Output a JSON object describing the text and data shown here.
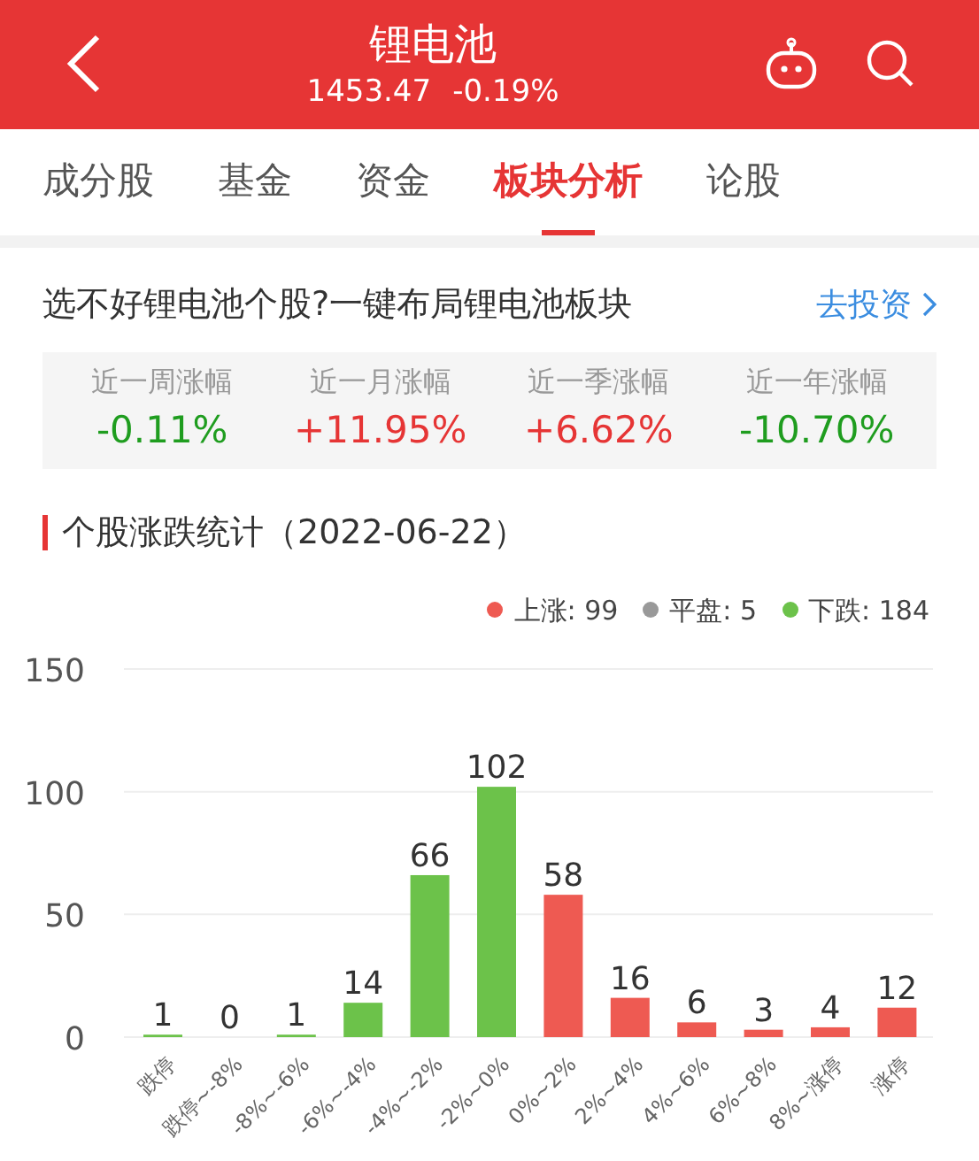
{
  "header": {
    "title": "锂电池",
    "price": "1453.47",
    "change": "-0.19%"
  },
  "tabs": [
    {
      "label": "成分股",
      "selected": false
    },
    {
      "label": "基金",
      "selected": false
    },
    {
      "label": "资金",
      "selected": false
    },
    {
      "label": "板块分析",
      "selected": true
    },
    {
      "label": "论股",
      "selected": false
    }
  ],
  "promo": {
    "text": "选不好锂电池个股?一键布局锂电池板块",
    "link": "去投资"
  },
  "returns": [
    {
      "label": "近一周涨幅",
      "value": "-0.11%",
      "color": "#1f9d1f"
    },
    {
      "label": "近一月涨幅",
      "value": "+11.95%",
      "color": "#e63535"
    },
    {
      "label": "近一季涨幅",
      "value": "+6.62%",
      "color": "#e63535"
    },
    {
      "label": "近一年涨幅",
      "value": "-10.70%",
      "color": "#1f9d1f"
    }
  ],
  "section_title": "个股涨跌统计（2022-06-22）",
  "legend": [
    {
      "label": "上涨: 99",
      "color": "#ee5a52"
    },
    {
      "label": "平盘: 5",
      "color": "#999999"
    },
    {
      "label": "下跌: 184",
      "color": "#6cc24a"
    }
  ],
  "chart": {
    "chart_data": {
      "type": "bar",
      "categories": [
        "跌停",
        "跌停~-8%",
        "-8%~-6%",
        "-6%~-4%",
        "-4%~-2%",
        "-2%~0%",
        "0%~2%",
        "2%~4%",
        "4%~6%",
        "6%~8%",
        "8%~涨停",
        "涨停"
      ],
      "series": [
        {
          "color": "#6cc24a",
          "values": [
            1,
            0,
            1,
            14,
            66,
            102,
            null,
            null,
            null,
            null,
            null,
            null
          ]
        },
        {
          "color": "#ee5a52",
          "values": [
            null,
            null,
            null,
            null,
            null,
            null,
            58,
            16,
            6,
            3,
            4,
            12
          ]
        }
      ],
      "ylim": [
        0,
        150
      ],
      "yticks": [
        0,
        50,
        100,
        150
      ],
      "data_labels": true
    }
  }
}
